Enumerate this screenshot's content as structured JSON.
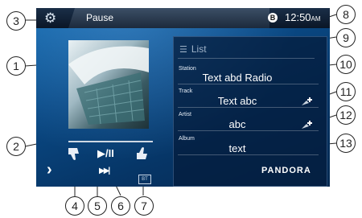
{
  "status_bar": {
    "status": "Pause",
    "bluetooth_symbol": "B",
    "time": "12:50",
    "ampm": "AM"
  },
  "list": {
    "title": "List"
  },
  "fields": {
    "station": {
      "label": "Station",
      "value": "Text abd Radio"
    },
    "track": {
      "label": "Track",
      "value": "Text abc"
    },
    "artist": {
      "label": "Artist",
      "value": "abc"
    },
    "album": {
      "label": "Album",
      "value": "text"
    }
  },
  "brand": "PANDORA",
  "controls": {
    "play_pause": "▶/II",
    "next": "▶▶|",
    "bt_badge": "BT",
    "chevron": "›"
  },
  "callouts": [
    "1",
    "2",
    "3",
    "4",
    "5",
    "6",
    "7",
    "8",
    "9",
    "10",
    "11",
    "12",
    "13"
  ],
  "icons": {
    "settings": "gear-icon",
    "thumbs_down": "thumbs-down-icon",
    "thumbs_up": "thumbs-up-icon",
    "add": "plus-icon"
  },
  "colors": {
    "screen": "#0a4a86",
    "panel": "#041c3c"
  }
}
